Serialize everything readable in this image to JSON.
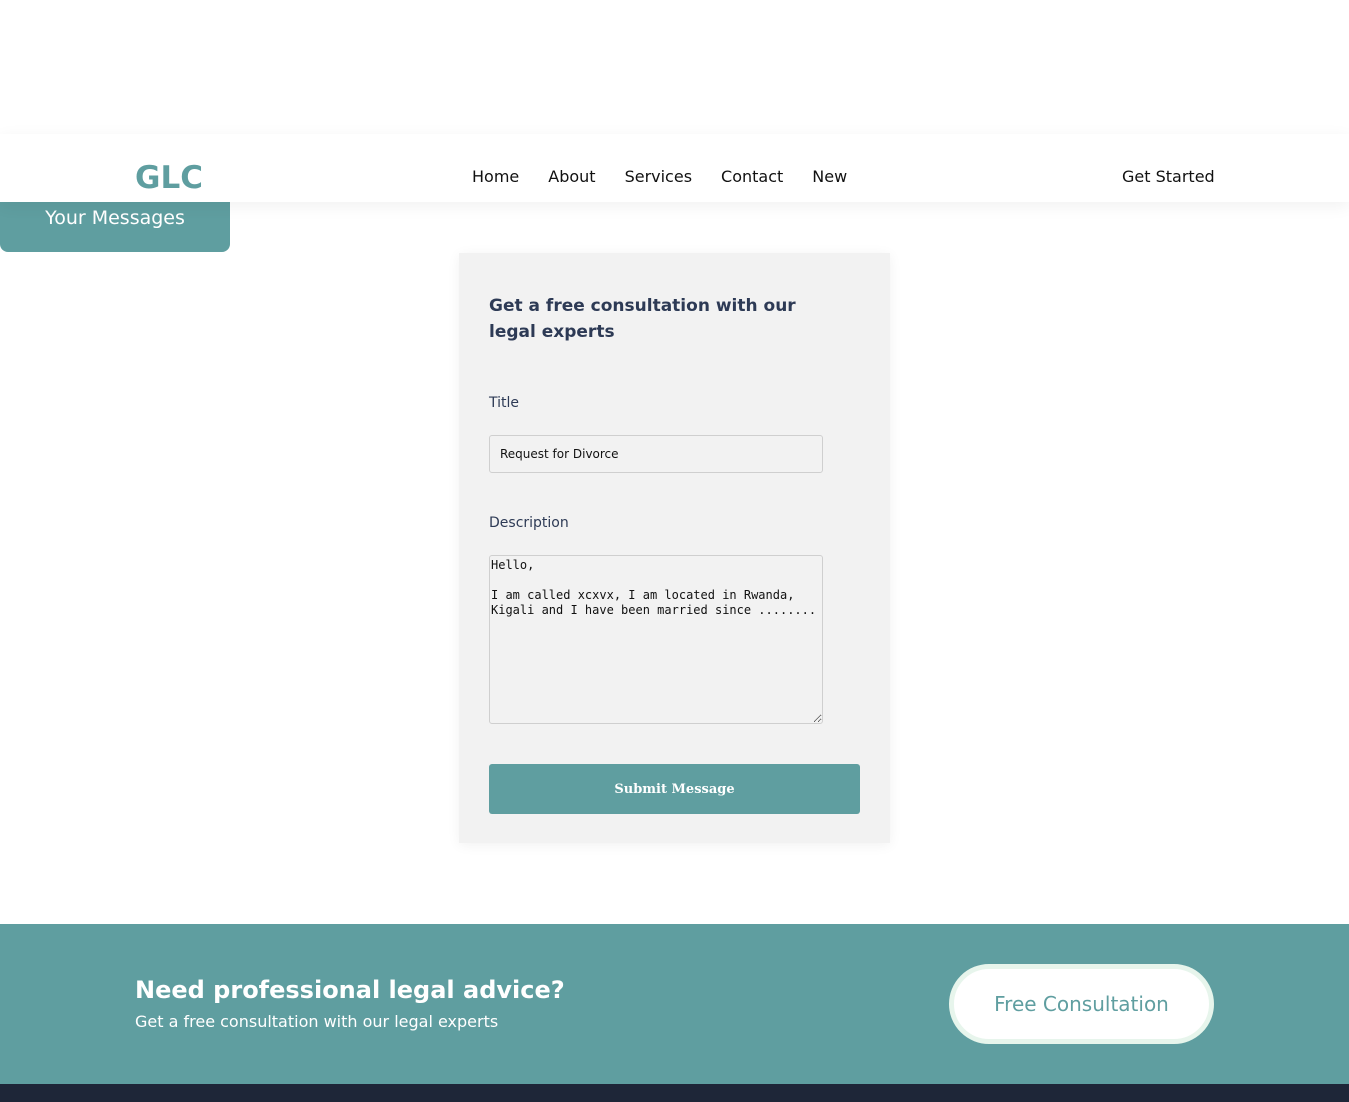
{
  "navbar": {
    "logo": "GLC",
    "links": [
      {
        "label": "Home"
      },
      {
        "label": "About"
      },
      {
        "label": "Services"
      },
      {
        "label": "Contact"
      },
      {
        "label": "New"
      }
    ],
    "cta_label": "Get Started"
  },
  "sidebar": {
    "messages_label": "Your Messages"
  },
  "form": {
    "heading": "Get a free consultation with our legal experts",
    "title_label": "Title",
    "title_value": "Request for Divorce",
    "description_label": "Description",
    "description_value": "Hello,\n\nI am called xcxvx, I am located in Rwanda, Kigali and I have been married since ........",
    "submit_label": "Submit Message"
  },
  "cta_banner": {
    "heading": "Need professional legal advice?",
    "subheading": "Get a free consultation with our legal experts",
    "button_label": "Free Consultation"
  },
  "colors": {
    "accent": "#5f9ea0",
    "footer": "#1e2638"
  }
}
